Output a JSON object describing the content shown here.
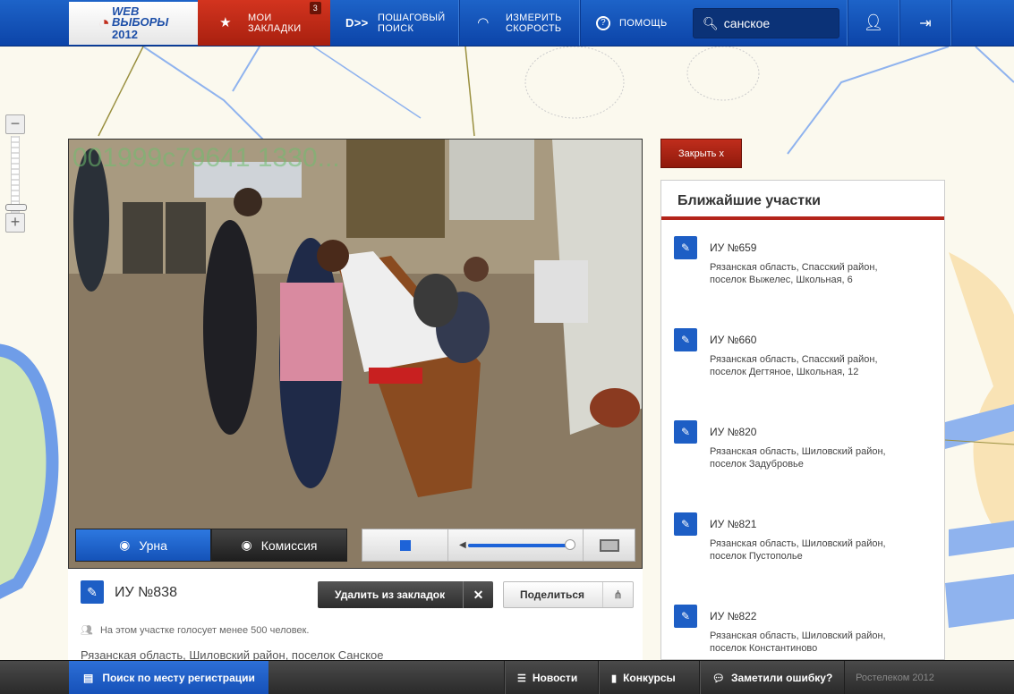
{
  "topbar": {
    "logo": {
      "line1": "WEB",
      "line2": "ВЫБОРЫ",
      "year": "2012"
    },
    "bookmarks": {
      "line1": "МОИ",
      "line2": "ЗАКЛАДКИ",
      "count": "3"
    },
    "step_search": {
      "line1": "ПОШАГОВЫЙ",
      "line2": "ПОИСК"
    },
    "speed": {
      "line1": "ИЗМЕРИТЬ",
      "line2": "СКОРОСТЬ"
    },
    "help": "ПОМОЩЬ",
    "search": {
      "value": "санское"
    }
  },
  "video": {
    "overlay_id": "001999c79641 1330...",
    "cameras": {
      "urn": "Урна",
      "commission": "Комиссия"
    },
    "volume_percent": 95
  },
  "station": {
    "title": "ИУ №838",
    "delete_bookmark": "Удалить из закладок",
    "share": "Поделиться",
    "voters_note": "На этом участке голосует менее 500 человек.",
    "address": "Рязанская область, Шиловский район, поселок Санское"
  },
  "close_button": "Закрыть  x",
  "nearest": {
    "title": "Ближайшие участки",
    "items": [
      {
        "title": "ИУ №659",
        "addr1": "Рязанская область, Спасский район,",
        "addr2": "поселок Выжелес, Школьная, 6"
      },
      {
        "title": "ИУ №660",
        "addr1": "Рязанская область, Спасский район,",
        "addr2": "поселок Дегтяное, Школьная, 12"
      },
      {
        "title": "ИУ №820",
        "addr1": "Рязанская область, Шиловский район,",
        "addr2": "поселок Задубровье"
      },
      {
        "title": "ИУ №821",
        "addr1": "Рязанская область, Шиловский район,",
        "addr2": "поселок Пустополье"
      },
      {
        "title": "ИУ №822",
        "addr1": "Рязанская область, Шиловский район,",
        "addr2": "поселок Константиново"
      }
    ]
  },
  "footer": {
    "reg_search": "Поиск по месту регистрации",
    "news": "Новости",
    "contests": "Конкурсы",
    "report_error": "Заметили ошибку?",
    "copyright": "Ростелеком 2012"
  },
  "colors": {
    "brand_blue": "#1d63c8",
    "accent_red": "#b3241a"
  }
}
